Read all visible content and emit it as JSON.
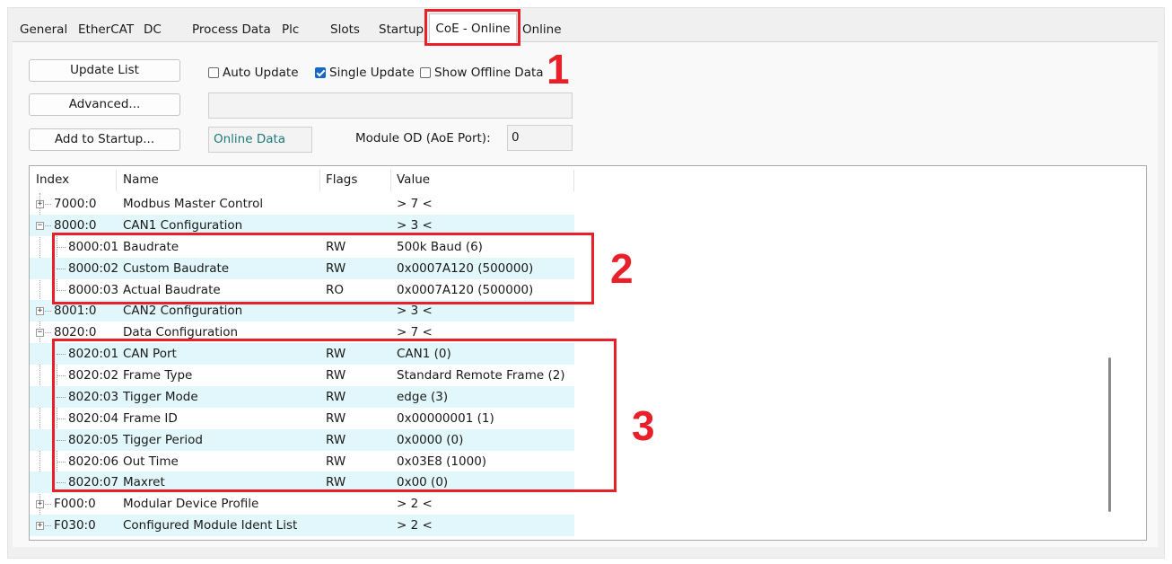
{
  "tabs": [
    {
      "label": "General",
      "active": false
    },
    {
      "label": "EtherCAT",
      "active": false
    },
    {
      "label": "DC",
      "active": false
    },
    {
      "label": "Process Data",
      "active": false
    },
    {
      "label": "Plc",
      "active": false
    },
    {
      "label": "Slots",
      "active": false
    },
    {
      "label": "Startup",
      "active": false
    },
    {
      "label": "CoE - Online",
      "active": true
    },
    {
      "label": "Online",
      "active": false
    }
  ],
  "buttons": {
    "update_list": "Update List",
    "advanced": "Advanced...",
    "add_to_startup": "Add to Startup..."
  },
  "options": {
    "auto_update": {
      "label": "Auto Update",
      "checked": false
    },
    "single_update": {
      "label": "Single Update",
      "checked": true
    },
    "show_offline": {
      "label": "Show Offline Data",
      "checked": false
    }
  },
  "status": {
    "message": "",
    "online_data": "Online Data",
    "module_od_label": "Module OD (AoE Port):",
    "module_od_value": "0"
  },
  "table": {
    "columns": [
      "Index",
      "Name",
      "Flags",
      "Value"
    ],
    "rows": [
      {
        "index": "7000:0",
        "name": "Modbus Master Control",
        "flags": "",
        "value": "> 7 <",
        "level": 0,
        "expander": "+"
      },
      {
        "index": "8000:0",
        "name": "CAN1 Configuration",
        "flags": "",
        "value": "> 3 <",
        "level": 0,
        "expander": "−"
      },
      {
        "index": "8000:01",
        "name": "Baudrate",
        "flags": "RW",
        "value": "500k Baud (6)",
        "level": 1
      },
      {
        "index": "8000:02",
        "name": "Custom Baudrate",
        "flags": "RW",
        "value": "0x0007A120 (500000)",
        "level": 1
      },
      {
        "index": "8000:03",
        "name": "Actual Baudrate",
        "flags": "RO",
        "value": "0x0007A120 (500000)",
        "level": 1
      },
      {
        "index": "8001:0",
        "name": "CAN2 Configuration",
        "flags": "",
        "value": "> 3 <",
        "level": 0,
        "expander": "+"
      },
      {
        "index": "8020:0",
        "name": "Data Configuration",
        "flags": "",
        "value": "> 7 <",
        "level": 0,
        "expander": "−"
      },
      {
        "index": "8020:01",
        "name": "CAN Port",
        "flags": "RW",
        "value": "CAN1 (0)",
        "level": 1
      },
      {
        "index": "8020:02",
        "name": "Frame Type",
        "flags": "RW",
        "value": "Standard Remote Frame (2)",
        "level": 1
      },
      {
        "index": "8020:03",
        "name": "Tigger Mode",
        "flags": "RW",
        "value": "edge (3)",
        "level": 1
      },
      {
        "index": "8020:04",
        "name": "Frame ID",
        "flags": "RW",
        "value": "0x00000001 (1)",
        "level": 1
      },
      {
        "index": "8020:05",
        "name": "Tigger Period",
        "flags": "RW",
        "value": "0x0000 (0)",
        "level": 1
      },
      {
        "index": "8020:06",
        "name": "Out Time",
        "flags": "RW",
        "value": "0x03E8 (1000)",
        "level": 1
      },
      {
        "index": "8020:07",
        "name": "Maxret",
        "flags": "RW",
        "value": "0x00 (0)",
        "level": 1
      },
      {
        "index": "F000:0",
        "name": "Modular Device Profile",
        "flags": "",
        "value": "> 2 <",
        "level": 0,
        "expander": "+"
      },
      {
        "index": "F030:0",
        "name": "Configured Module Ident List",
        "flags": "",
        "value": "> 2 <",
        "level": 0,
        "expander": "+"
      }
    ]
  },
  "annotations": [
    "1",
    "2",
    "3"
  ],
  "colors": {
    "annotation": "#e8202a",
    "row_alt": "#e1f7fb",
    "checkbox_checked": "#1668c8",
    "online_data_text": "#1f7a7a"
  }
}
